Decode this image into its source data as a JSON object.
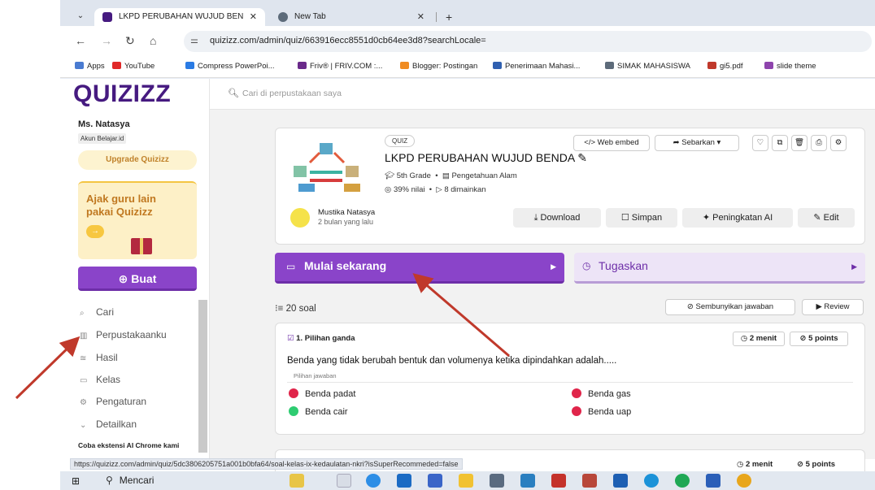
{
  "browser": {
    "tabs": [
      {
        "title": "LKPD PERUBAHAN WUJUD BEN",
        "active": true
      },
      {
        "title": "New Tab",
        "active": false
      }
    ],
    "url": "quizizz.com/admin/quiz/663916ecc8551d0cb64ee3d8?searchLocale=",
    "bookmarks": [
      {
        "label": "Apps",
        "color": "#4a7bd1"
      },
      {
        "label": "YouTube",
        "color": "#e02828"
      },
      {
        "label": "Compress PowerPoi...",
        "color": "#2a7be4"
      },
      {
        "label": "Friv® | FRIV.COM :...",
        "color": "#6a2a8a"
      },
      {
        "label": "Blogger: Postingan",
        "color": "#f08b21"
      },
      {
        "label": "Penerimaan Mahasi...",
        "color": "#3060b0"
      },
      {
        "label": "SIMAK MAHASISWA",
        "color": "#5d6b7a"
      },
      {
        "label": "gi5.pdf",
        "color": "#c0392b"
      },
      {
        "label": "slide theme",
        "color": "#8e44ad"
      }
    ]
  },
  "sidebar": {
    "logo": "QUIZIZZ",
    "user_name": "Ms. Natasya",
    "account": "Akun Belajar.id",
    "upgrade_label": "Upgrade Quizizz",
    "promo_text": "Ajak guru lain pakai Quizizz",
    "promo_arrow": "→",
    "create_label": "⊕ Buat",
    "nav": [
      {
        "icon": "⌕",
        "label": "Cari"
      },
      {
        "icon": "▥",
        "label": "Perpustakaanku"
      },
      {
        "icon": "≊",
        "label": "Hasil"
      },
      {
        "icon": "▭",
        "label": "Kelas"
      },
      {
        "icon": "⚙",
        "label": "Pengaturan"
      },
      {
        "icon": "⌄",
        "label": "Detailkan"
      }
    ],
    "ai_promo": "Coba ekstensi AI Chrome kami"
  },
  "search": {
    "placeholder": "Cari di perpustakaan saya"
  },
  "quiz": {
    "type_pill": "QUIZ",
    "title": "LKPD PERUBAHAN WUJUD BENDA",
    "grade": "5th Grade",
    "subject": "Pengetahuan Alam",
    "accuracy": "39% nilai",
    "plays": "8 dimainkan",
    "author": "Mustika Natasya",
    "author_time": "2 bulan yang lalu",
    "header_buttons": {
      "embed": "</> Web embed",
      "share": "➦ Sebarkan ▾"
    },
    "actions": {
      "download": "⤓ Download",
      "save": "☐ Simpan",
      "ai": "✦ Peningkatan AI",
      "edit": "✎ Edit"
    },
    "start_label": "Mulai sekarang",
    "assign_label": "Tugaskan",
    "question_count": "20 soal",
    "hide_answers": "Sembunyikan jawaban",
    "review": "Review"
  },
  "questions": [
    {
      "type": "1. Pilihan ganda",
      "time": "2 menit",
      "points": "5 points",
      "text": "Benda yang tidak berubah bentuk dan volumenya ketika dipindahkan adalah.....",
      "answer_label": "Pilihan jawaban",
      "answers": [
        {
          "text": "Benda padat",
          "correct": false
        },
        {
          "text": "Benda gas",
          "correct": false
        },
        {
          "text": "Benda cair",
          "correct": true
        },
        {
          "text": "Benda uap",
          "correct": false
        }
      ]
    },
    {
      "time": "2 menit",
      "points": "5 points"
    }
  ],
  "colors": {
    "brand": "#461a80",
    "primary": "#8a44c9",
    "correct": "#2ecc71",
    "incorrect": "#e0254a",
    "annotation_arrow": "#c0392b"
  },
  "status_url": "https://quizizz.com/admin/quiz/5dc3806205751a001b0bfa64/soal-kelas-ix-kedaulatan-nkri?isSuperRecommeded=false",
  "taskbar": {
    "search_label": "Mencari"
  }
}
